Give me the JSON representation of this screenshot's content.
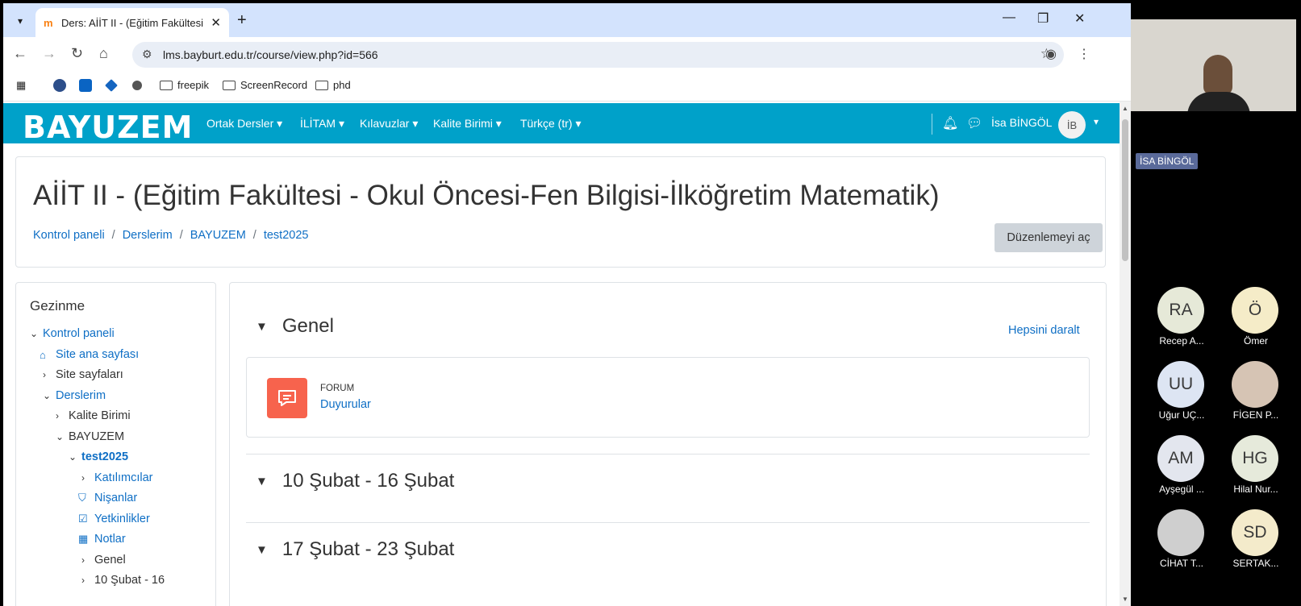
{
  "browser": {
    "tab_title": "Ders: AİİT II - (Eğitim Fakültesi -",
    "tab_favicon": "m",
    "new_tab": "+",
    "url": "lms.bayburt.edu.tr/course/view.php?id=566",
    "bookmarks": [
      "freepik",
      "ScreenRecord",
      "phd"
    ]
  },
  "navbar": {
    "logo": "BAYUZEM",
    "menu": [
      "Ortak Dersler",
      "İLİTAM",
      "Kılavuzlar",
      "Kalite Birimi",
      "Türkçe (tr)"
    ],
    "user": "İsa BİNGÖL",
    "user_initials": "İB",
    "color": "#00a1c9"
  },
  "header": {
    "title": "AİİT II - (Eğitim Fakültesi - Okul Öncesi-Fen Bilgisi-İlköğretim Matematik)",
    "breadcrumb": [
      "Kontrol paneli",
      "Derslerim",
      "BAYUZEM",
      "test2025"
    ],
    "edit_button": "Düzenlemeyi aç"
  },
  "sidebar": {
    "title": "Gezinme",
    "items": [
      "Kontrol paneli",
      "Site ana sayfası",
      "Site sayfaları",
      "Derslerim",
      "Kalite Birimi",
      "BAYUZEM",
      "test2025",
      "Katılımcılar",
      "Nişanlar",
      "Yetkinlikler",
      "Notlar",
      "Genel",
      "10 Şubat - 16"
    ]
  },
  "content": {
    "collapse_all": "Hepsini daralt",
    "sections": [
      "Genel",
      "10 Şubat - 16 Şubat",
      "17 Şubat - 23 Şubat"
    ],
    "activity_type": "FORUM",
    "activity_name": "Duyurular",
    "forum_color": "#f7634d"
  },
  "meet": {
    "self_name": "İSA BİNGÖL",
    "participants": [
      {
        "initials": "RA",
        "name": "Recep A...",
        "color": "#e6e9d8"
      },
      {
        "initials": "Ö",
        "name": "Ömer",
        "color": "#f5ecc8"
      },
      {
        "initials": "UU",
        "name": "Uğur UÇ...",
        "color": "#dde5f3"
      },
      {
        "initials": "",
        "name": "FİGEN P...",
        "color": "#d6c4b4"
      },
      {
        "initials": "AM",
        "name": "Ayşegül ...",
        "color": "#e3e6ee"
      },
      {
        "initials": "HG",
        "name": "Hilal Nur...",
        "color": "#e6eadb"
      },
      {
        "initials": "",
        "name": "CİHAT T...",
        "color": "#cfcfcf"
      },
      {
        "initials": "SD",
        "name": "SERTAK...",
        "color": "#f4ebcb"
      }
    ]
  }
}
